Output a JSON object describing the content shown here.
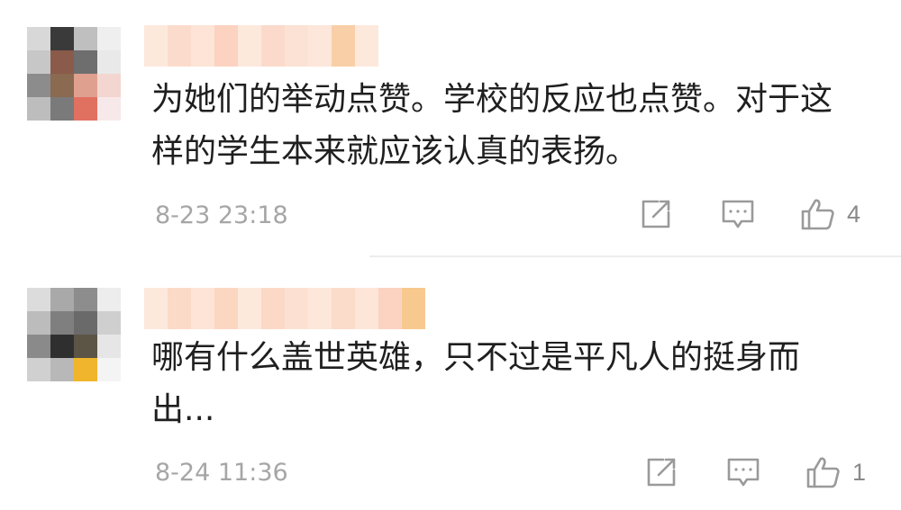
{
  "comments": [
    {
      "text": "为她们的举动点赞。学校的反应也点赞。对于这样的学生本来就应该认真的表扬。",
      "time": "8-23 23:18",
      "likes": "4",
      "avatar_colors": [
        "#d8d8d8",
        "#3a3a3a",
        "#bfbfbf",
        "#efefef",
        "#c7c7c7",
        "#8a5a4a",
        "#6e6e6e",
        "#e9e9e9",
        "#8c8c8c",
        "#8a6a50",
        "#e0a090",
        "#f3d6d0",
        "#bdbdbd",
        "#7a7a7a",
        "#e07060",
        "#f7e9e9"
      ],
      "name_colors": [
        "#fde8dc",
        "#fbdccc",
        "#fde4d6",
        "#fbd3c0",
        "#fde8dc",
        "#fbdacb",
        "#fce2d4",
        "#fde6da",
        "#f9cfa8",
        "#fde8dc"
      ]
    },
    {
      "text": "哪有什么盖世英雄，只不过是平凡人的挺身而出...",
      "time": "8-24 11:36",
      "likes": "1",
      "avatar_colors": [
        "#dcdcdc",
        "#a9a9a9",
        "#8d8d8d",
        "#ededed",
        "#bcbcbc",
        "#7f7f7f",
        "#6a6a6a",
        "#cfcfcf",
        "#8a8a8a",
        "#2f2f2f",
        "#5c5546",
        "#e6e6e6",
        "#d0d0d0",
        "#b8b8b8",
        "#f0b52c",
        "#f4f4f4"
      ],
      "name_colors": [
        "#fde8dc",
        "#fcdac8",
        "#fde4d6",
        "#fbd7c2",
        "#fde8dc",
        "#fbd9c6",
        "#fce1d2",
        "#fde7da",
        "#fbdccb",
        "#fde5d8",
        "#fbd3c0",
        "#f7c98f"
      ]
    }
  ],
  "icons": {
    "share": "share-icon",
    "comment": "comment-icon",
    "like": "thumbs-up-icon"
  }
}
